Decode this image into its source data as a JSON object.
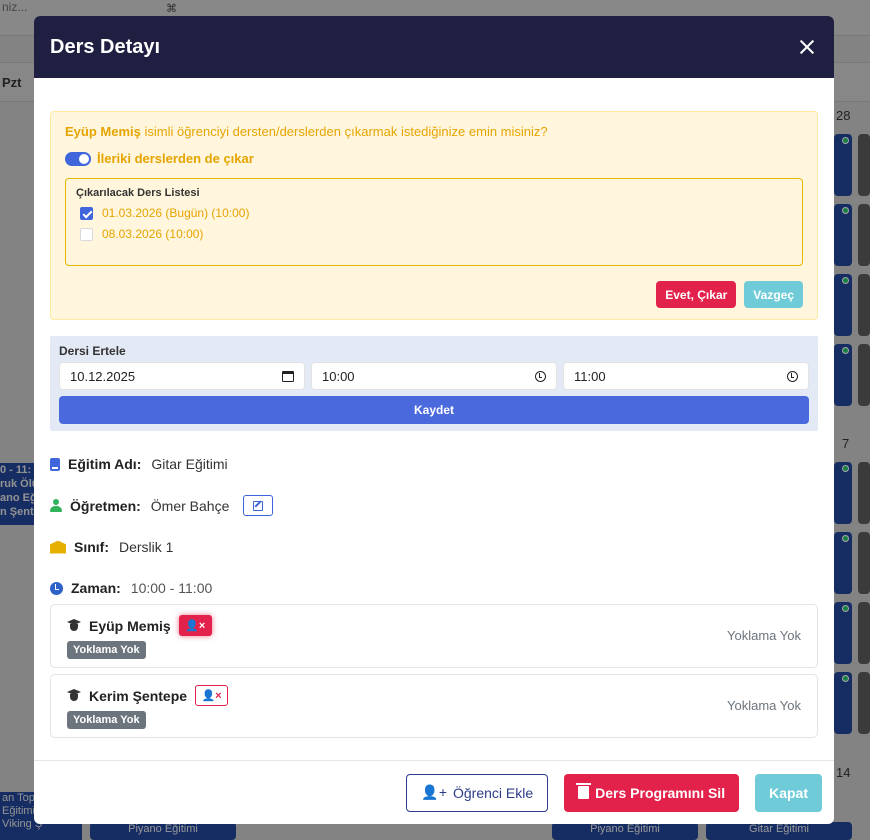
{
  "background": {
    "search_placeholder": "niz...",
    "search_shortcut": "⌘",
    "day_header": "Pzt",
    "cell_numbers": [
      "28",
      "7",
      "14"
    ],
    "left_event_lines": [
      "0 - 11:",
      "ruk Ölü",
      "ano Eğit",
      "n Şente"
    ],
    "bottom_left_event_lines": [
      "an Top",
      "Eğitimi",
      "Viking Ş"
    ],
    "bottom_events": [
      "Piyano Eğitimi",
      "Piyano Eğitimi",
      "Gitar Eğitimi"
    ]
  },
  "modal": {
    "title": "Ders Detayı",
    "warning": {
      "student_name": "Eyüp Memiş",
      "message_rest": " isimli öğrenciyi dersten/derslerden çıkarmak istediğinize emin misiniz?",
      "toggle_label": "İleriki derslerden de çıkar",
      "toggle_on": true,
      "list_title": "Çıkarılacak Ders Listesi",
      "lessons": [
        {
          "label": "01.03.2026 (Bugün) (10:00)",
          "checked": true
        },
        {
          "label": "08.03.2026 (10:00)",
          "checked": false
        }
      ],
      "confirm_label": "Evet, Çıkar",
      "cancel_label": "Vazgeç"
    },
    "postpone": {
      "label": "Dersi Ertele",
      "date": "10.12.2025",
      "start": "10:00",
      "end": "11:00",
      "save_label": "Kaydet"
    },
    "info": {
      "training_key": "Eğitim Adı:",
      "training_val": "Gitar Eğitimi",
      "teacher_key": "Öğretmen:",
      "teacher_val": "Ömer Bahçe",
      "class_key": "Sınıf:",
      "class_val": "Derslik 1",
      "time_key": "Zaman:",
      "time_val": "10:00 - 11:00"
    },
    "students": [
      {
        "name": "Eyüp Memiş",
        "badge": "Yoklama Yok",
        "status": "Yoklama Yok"
      },
      {
        "name": "Kerim Şentepe",
        "badge": "Yoklama Yok",
        "status": "Yoklama Yok"
      }
    ],
    "footer": {
      "add_student": "Öğrenci Ekle",
      "delete_program": "Ders Programını Sil",
      "close": "Kapat"
    }
  },
  "colors": {
    "header": "#1f2041",
    "accent_blue": "#4a69dd",
    "danger": "#e3224b",
    "warning_text": "#e6a400",
    "cyan": "#6fcbd7"
  }
}
